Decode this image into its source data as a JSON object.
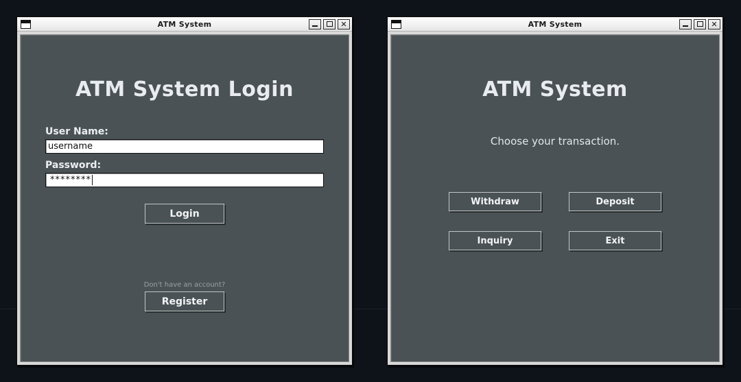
{
  "desktop": {
    "background_color": "#0e1219"
  },
  "login_window": {
    "title": "ATM System",
    "icon": "window-icon",
    "controls": {
      "minimize": "_",
      "maximize": "□",
      "close": "✕"
    },
    "heading": "ATM System Login",
    "username": {
      "label": "User Name:",
      "value": "username",
      "placeholder": ""
    },
    "password": {
      "label": "Password:",
      "value": "********",
      "placeholder": ""
    },
    "login_button": "Login",
    "register_hint": "Don't have an account?",
    "register_button": "Register"
  },
  "menu_window": {
    "title": "ATM System",
    "icon": "window-icon",
    "controls": {
      "minimize": "_",
      "maximize": "□",
      "close": "✕"
    },
    "heading": "ATM System",
    "subtitle": "Choose your transaction.",
    "buttons": [
      {
        "label": "Withdraw"
      },
      {
        "label": "Deposit"
      },
      {
        "label": "Inquiry"
      },
      {
        "label": "Exit"
      }
    ]
  },
  "colors": {
    "window_frame": "#d9d9d9",
    "titlebar": "#f4f4f4",
    "client_background": "#4a5255",
    "text_primary": "#eceff1",
    "text_muted": "#9aa1a4",
    "input_background": "#ffffff"
  }
}
